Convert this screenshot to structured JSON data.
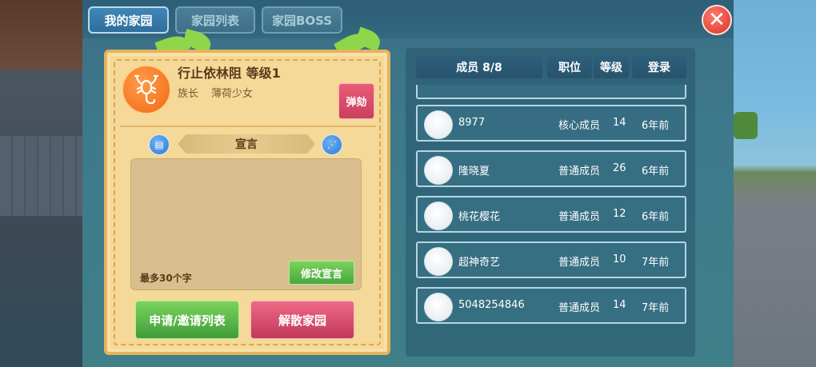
{
  "tabs": [
    {
      "label": "我的家园",
      "active": true
    },
    {
      "label": "家园列表",
      "active": false
    },
    {
      "label": "家园BOSS",
      "active": false
    }
  ],
  "close_icon": "close-x-icon",
  "home": {
    "name_line": "行止依林阻 等级1",
    "leader_label": "族长",
    "leader_name": "薄荷少女",
    "impeach_label": "弹劾",
    "declaration_title": "宣言",
    "max_chars_note": "最多30个字",
    "edit_declaration_label": "修改宣言",
    "apply_list_label": "申请/邀请列表",
    "disband_label": "解散家园"
  },
  "members_header": {
    "members": "成员 8/8",
    "role": "职位",
    "level": "等级",
    "login": "登录"
  },
  "members": [
    {
      "name": "8977",
      "role": "核心成员",
      "level": "14",
      "login": "6年前"
    },
    {
      "name": "隆晓夏",
      "role": "普通成员",
      "level": "26",
      "login": "6年前"
    },
    {
      "name": "桃花樱花",
      "role": "普通成员",
      "level": "12",
      "login": "6年前"
    },
    {
      "name": "超神奇艺",
      "role": "普通成员",
      "level": "10",
      "login": "7年前"
    },
    {
      "name": "5048254846",
      "role": "普通成员",
      "level": "14",
      "login": "7年前"
    }
  ],
  "colors": {
    "card_bg": "#f4d998",
    "card_border": "#e6b25a",
    "green_button": "#4aa640",
    "pink_button": "#c93f5c",
    "panel_bg": "#3e7a8c"
  }
}
